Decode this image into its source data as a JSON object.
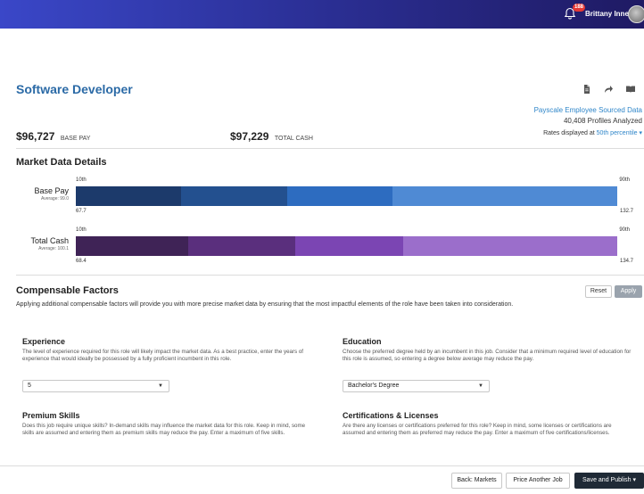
{
  "header": {
    "notification_count": "188",
    "user_name": "Brittany Innes"
  },
  "job": {
    "title": "Software Developer"
  },
  "source": {
    "link_text": "Payscale Employee Sourced Data",
    "profiles_text": "40,408 Profiles Analyzed",
    "rates_label": "Rates displayed at",
    "percentile_value": "50th percentile"
  },
  "pay": {
    "base_amount": "$96,727",
    "base_label": "BASE PAY",
    "total_amount": "$97,229",
    "total_label": "TOTAL CASH"
  },
  "market": {
    "section_title": "Market Data Details",
    "base": {
      "label": "Base Pay",
      "average": "Average: 99.0",
      "low_label": "10th",
      "high_label": "90th",
      "min_value": "67.7",
      "max_value": "132.7",
      "segments": [
        0.195,
        0.195,
        0.195,
        0.415
      ],
      "colors": [
        "#1c3a6b",
        "#23508f",
        "#2d6cc0",
        "#4f8ad4"
      ]
    },
    "total": {
      "label": "Total Cash",
      "average": "Average: 100.1",
      "low_label": "10th",
      "high_label": "90th",
      "min_value": "68.4",
      "max_value": "134.7",
      "segments": [
        0.208,
        0.198,
        0.198,
        0.396
      ],
      "colors": [
        "#3f2356",
        "#5a2f7d",
        "#7b45b3",
        "#9b6ecb"
      ]
    }
  },
  "compensable": {
    "section_title": "Compensable Factors",
    "reset_label": "Reset",
    "apply_label": "Apply",
    "description": "Applying additional compensable factors will provide you with more precise market data by ensuring that the most impactful elements of the role have been taken into consideration.",
    "experience": {
      "title": "Experience",
      "description": "The level of experience required for this role will likely impact the market data. As a best practice, enter the years of experience that would ideally be possessed by a fully proficient incumbent in this role.",
      "value": "5"
    },
    "education": {
      "title": "Education",
      "description": "Choose the preferred degree held by an incumbent in this job. Consider that a minimum required level of education for this role is assumed, so entering a degree below average may reduce the pay.",
      "value": "Bachelor's Degree"
    },
    "skills": {
      "title": "Premium Skills",
      "description": "Does this job require unique skills? In-demand skills may influence the market data for this role. Keep in mind, some skills are assumed and entering them as premium skills may reduce the pay. Enter a maximum of five skills."
    },
    "certifications": {
      "title": "Certifications & Licenses",
      "description": "Are there any licenses or certifications preferred for this role? Keep in mind, some licenses or certifications are assumed and entering them as preferred may reduce the pay. Enter a maximum of five certifications/licenses."
    }
  },
  "footer": {
    "back_label": "Back: Markets",
    "price_another_label": "Price Another Job",
    "save_publish_label": "Save and Publish"
  },
  "icons": {
    "bell": "bell-icon",
    "document": "document-icon",
    "share": "share-icon",
    "book": "book-icon",
    "avatar": "user-avatar"
  }
}
